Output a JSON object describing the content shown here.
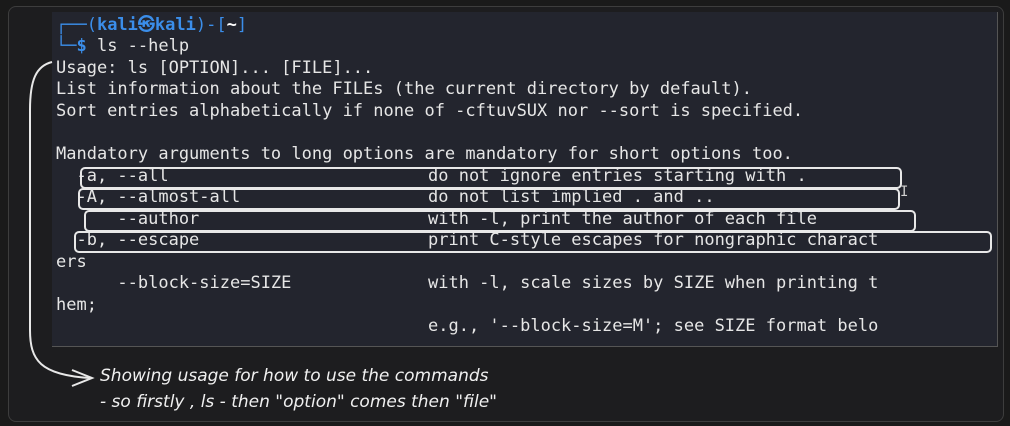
{
  "prompt": {
    "top_prefix": "┌──(",
    "user": "kali",
    "at": "㉿",
    "host": "kali",
    "mid": ")-[",
    "path": "~",
    "end": "]",
    "bottom_prefix": "└─",
    "dollar": "$",
    "command": " ls --help"
  },
  "output": {
    "usage": "Usage: ls [OPTION]... [FILE]...",
    "desc1": "List information about the FILEs (the current directory by default).",
    "desc2": "Sort entries alphabetically if none of -cftuvSUX nor --sort is specified.",
    "mandatory": "Mandatory arguments to long options are mandatory for short options too.",
    "options": [
      {
        "flag": "  -a, --all",
        "desc": "do not ignore entries starting with ."
      },
      {
        "flag": "  -A, --almost-all",
        "desc": "do not list implied . and .."
      },
      {
        "flag": "      --author",
        "desc": "with -l, print the author of each file"
      },
      {
        "flag": "  -b, --escape",
        "desc": "print C-style escapes for nongraphic charact"
      }
    ],
    "wrap1": "ers",
    "block_flag": "      --block-size=SIZE",
    "block_desc": "with -l, scale sizes by SIZE when printing t",
    "wrap2": "hem;",
    "eg": "e.g., '--block-size=M'; see SIZE format belo"
  },
  "annotation": {
    "line1": "Showing usage for how to use the commands",
    "line2": "- so firstly , ls - then \"option\" comes then \"file\""
  },
  "colors": {
    "terminal_bg": "#23252e",
    "prompt_blue": "#3b8eea",
    "text": "#e6e6e6"
  }
}
